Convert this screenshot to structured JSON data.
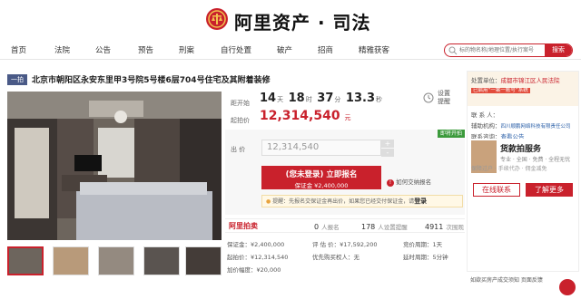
{
  "header": {
    "logo_text": "阿里资产 · 司法"
  },
  "nav": {
    "items": [
      "首页",
      "法院",
      "公告",
      "预告",
      "刑案",
      "自行处置",
      "破产",
      "招商",
      "精雅获客"
    ],
    "search_placeholder": "标的物名称/地理位置/执行案号",
    "search_button": "搜索"
  },
  "title": {
    "badge": "一拍",
    "text": "北京市朝阳区永安东里甲3号院5号楼6层704号住宅及其附着装修"
  },
  "price": {
    "countdown_label": "距开始",
    "days": "14",
    "days_unit": "天",
    "hours": "18",
    "hours_unit": "时",
    "minutes": "37",
    "minutes_unit": "分",
    "seconds": "13.3",
    "seconds_unit": "秒",
    "start_label": "起拍价",
    "start_price": "12,314,540",
    "currency": "元",
    "remind": "设置提醒"
  },
  "bid": {
    "tag": "即将开拍",
    "bid_label": "出 价",
    "bid_value": "12,314,540",
    "plus": "+",
    "minus": "-",
    "signup_main": "(您未登录) 立即报名",
    "signup_sub": "保证金 ¥2,400,000",
    "how_link": "如何交纳报名",
    "warn_text": "提醒：先报名交保证金再出价，如果您已经交付保证金，请",
    "warn_login": "登录"
  },
  "stats": {
    "logo": "阿里拍卖",
    "signup_count": "0",
    "signup_label": "人报名",
    "remind_count": "178",
    "remind_label": "人设置提醒",
    "view_count": "4911",
    "view_label": "次围观"
  },
  "info": {
    "deposit": "保证金：¥2,400,000",
    "appraisal": "评 估 价：¥17,592,200",
    "bid_period": "竞价周期：1天",
    "start_price": "起拍价：¥12,314,540",
    "priority": "优先购买权人：无",
    "extension": "延时周期：5分钟",
    "increment": "加价幅度：¥20,000"
  },
  "sidebar": {
    "court_label": "处置单位：",
    "court_name": "成都市锦江区人民法院",
    "verify": "已启用“一案一账号”系统",
    "contact_label": "联 系 人：",
    "assist_label": "辅助机构：",
    "assist_name": "四川顺鹏网络科技有限责任公司",
    "consult_label": "联系咨询：",
    "consult_link": "查看公告",
    "banner_title": "货款拍服务",
    "banner_sub": "专业 · 全国 · 免费 · 全程无忧",
    "tags": "保障过户 · 手续代办 · 佣金减免",
    "online_btn": "在线联系",
    "more_btn": "了解更多",
    "footer": "如欲买房产成交须知  页面反馈"
  }
}
